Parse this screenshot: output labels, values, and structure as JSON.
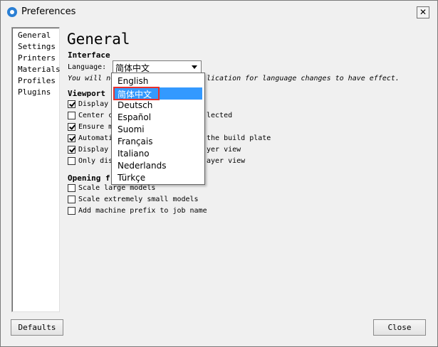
{
  "window": {
    "title": "Preferences",
    "close_glyph": "✕"
  },
  "nav": {
    "items": [
      "General",
      "Settings",
      "Printers",
      "Materials",
      "Profiles",
      "Plugins"
    ]
  },
  "page": {
    "title": "General",
    "interface_heading": "Interface",
    "language_label": "Language:",
    "language_value": "简体中文",
    "restart_note_start": "You will ne",
    "restart_note_end": "lication for language changes to have effect.",
    "viewport_heading": "Viewport",
    "viewport_options": [
      {
        "label": "Display",
        "checked": true
      },
      {
        "label": "Center c",
        "checked": false,
        "tail": "lected"
      },
      {
        "label": "Ensure m",
        "checked": true
      },
      {
        "label": "Automati",
        "checked": true,
        "tail": "the build plate"
      },
      {
        "label": "Display",
        "checked": true,
        "tail": "yer view"
      },
      {
        "label": "Only dis",
        "checked": false,
        "tail": "ayer view"
      }
    ],
    "opening_heading": "Opening f",
    "opening_options": [
      {
        "label": "Scale large models",
        "checked": false
      },
      {
        "label": "Scale extremely small models",
        "checked": false
      },
      {
        "label": "Add machine prefix to job name",
        "checked": false
      }
    ]
  },
  "language_dropdown": {
    "options": [
      "English",
      "简体中文",
      "Deutsch",
      "Español",
      "Suomi",
      "Français",
      "Italiano",
      "Nederlands",
      "Türkçe"
    ],
    "selected_index": 1,
    "highlight_color": "#e8312c",
    "selection_color": "#3399ff"
  },
  "footer": {
    "defaults_label": "Defaults",
    "close_label": "Close"
  }
}
